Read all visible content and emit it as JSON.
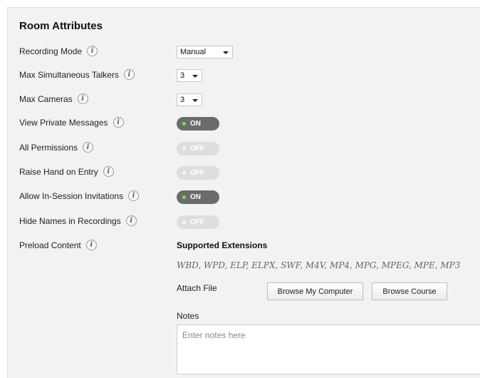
{
  "section": {
    "title": "Room Attributes"
  },
  "rows": {
    "recording_mode": "Recording Mode",
    "max_talkers": "Max Simultaneous Talkers",
    "max_cameras": "Max Cameras",
    "view_private": "View Private Messages",
    "all_permissions": "All Permissions",
    "raise_hand": "Raise Hand on Entry",
    "allow_invites": "Allow In-Session Invitations",
    "hide_names": "Hide Names in Recordings",
    "preload": "Preload Content"
  },
  "info_glyph": "i",
  "selects": {
    "recording_mode": "Manual",
    "max_talkers": "3",
    "max_cameras": "3"
  },
  "toggles": {
    "view_private": "ON",
    "all_permissions": "OFF",
    "raise_hand": "OFF",
    "allow_invites": "ON",
    "hide_names": "OFF"
  },
  "preload": {
    "supported_heading": "Supported Extensions",
    "extensions": "WBD, WPD, ELP, ELPX, SWF, M4V, MP4, MPG, MPEG, MPE, MP3",
    "attach_label": "Attach File",
    "browse_computer": "Browse My Computer",
    "browse_course": "Browse Course",
    "notes_label": "Notes",
    "notes_placeholder": "Enter notes here"
  },
  "colors": {
    "toggle_on": "#6b6b6b",
    "toggle_off": "#dedede",
    "on_indicator": "#7ee23a"
  },
  "icons": {
    "info": "info-icon",
    "dropdown": "chevron-down-icon",
    "status_dot": "status-dot-icon"
  }
}
